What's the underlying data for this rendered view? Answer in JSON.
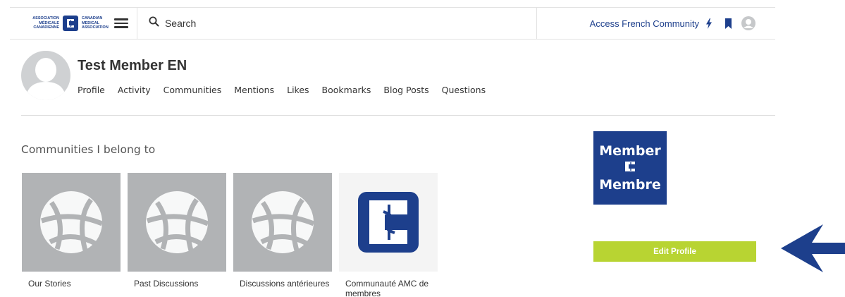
{
  "header": {
    "logo": {
      "left_lines": [
        "ASSOCIATION",
        "MÉDICALE",
        "CANADIENNE"
      ],
      "right_lines": [
        "CANADIAN",
        "MEDICAL",
        "ASSOCIATION"
      ]
    },
    "menu_icon": "hamburger-icon",
    "search": {
      "icon": "search-icon",
      "label": "Search"
    },
    "access_french": "Access French Community",
    "icons": [
      "bolt-icon",
      "bookmark-icon",
      "user-icon"
    ]
  },
  "profile": {
    "name": "Test Member EN",
    "avatar_icon": "default-avatar",
    "nav": [
      "Profile",
      "Activity",
      "Communities",
      "Mentions",
      "Likes",
      "Bookmarks",
      "Blog Posts",
      "Questions"
    ]
  },
  "communities": {
    "title": "Communities I belong to",
    "items": [
      {
        "label": "Our Stories",
        "image": "globe-icon"
      },
      {
        "label": "Past Discussions",
        "image": "globe-icon"
      },
      {
        "label": "Discussions antérieures",
        "image": "globe-icon"
      },
      {
        "label": "Communauté AMC de membres",
        "image": "cma-logo"
      }
    ]
  },
  "badge": {
    "line1": "Member",
    "line2": "Membre",
    "icon": "cma-emblem"
  },
  "edit_profile": "Edit Profile",
  "colors": {
    "brand_blue": "#1d3f8c",
    "accent_green": "#b8d432",
    "tile_gray": "#b1b3b5"
  }
}
